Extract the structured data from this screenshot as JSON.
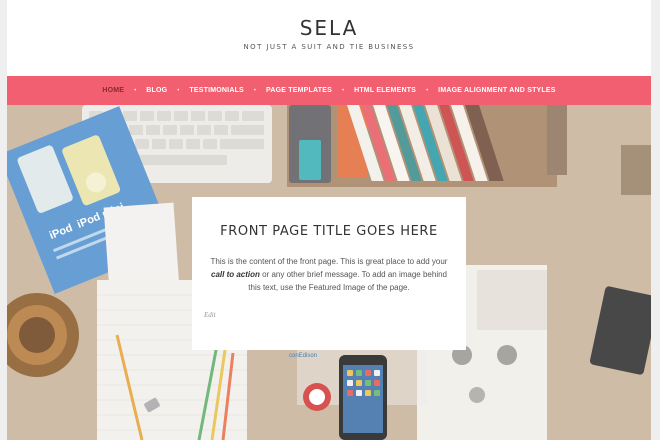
{
  "site": {
    "title": "SELA",
    "description": "NOT JUST A SUIT AND TIE BUSINESS"
  },
  "nav": {
    "items": [
      {
        "label": "HOME",
        "current": true
      },
      {
        "label": "BLOG"
      },
      {
        "label": "TESTIMONIALS"
      },
      {
        "label": "PAGE TEMPLATES"
      },
      {
        "label": "HTML ELEMENTS"
      },
      {
        "label": "IMAGE ALIGNMENT AND STYLES"
      }
    ]
  },
  "hero": {
    "title": "FRONT PAGE TITLE GOES HERE",
    "text_before": "This is the content of the front page. This is great place to add your ",
    "text_emphasis": "call to action",
    "text_after": " or any other brief message. To add an image behind this text, use the Featured Image of the page.",
    "edit_label": "Edit",
    "image_text": {
      "ipod_label": "iPod",
      "ipod_mini_label": "iPod mini",
      "brand_label": "conEdison"
    }
  },
  "colors": {
    "accent": "#f25f70",
    "nav_current": "#8a2a33",
    "background": "#efefef"
  }
}
